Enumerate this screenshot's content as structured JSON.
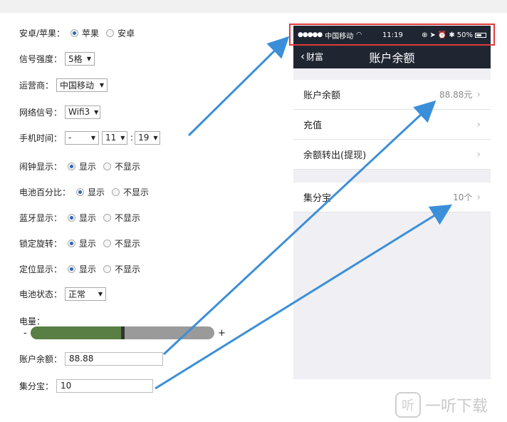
{
  "form": {
    "platform": {
      "label": "安卓/苹果：",
      "opt1": "苹果",
      "opt2": "安卓"
    },
    "signal": {
      "label": "信号强度：",
      "value": "5格"
    },
    "carrier": {
      "label": "运营商：",
      "value": "中国移动"
    },
    "network": {
      "label": "网络信号：",
      "value": "Wifi3"
    },
    "time": {
      "label": "手机时间：",
      "ampm": "-",
      "hour": "11",
      "colon": ":",
      "minute": "19"
    },
    "alarm": {
      "label": "闹钟显示：",
      "show": "显示",
      "hide": "不显示"
    },
    "battery_pct": {
      "label": "电池百分比：",
      "show": "显示",
      "hide": "不显示"
    },
    "bluetooth": {
      "label": "蓝牙显示：",
      "show": "显示",
      "hide": "不显示"
    },
    "rotation": {
      "label": "锁定旋转：",
      "show": "显示",
      "hide": "不显示"
    },
    "location": {
      "label": "定位显示：",
      "show": "显示",
      "hide": "不显示"
    },
    "battery_state": {
      "label": "电池状态：",
      "value": "正常"
    },
    "power": {
      "label": "电量：",
      "minus": "-",
      "plus": "+",
      "level": 0.5
    },
    "balance": {
      "label": "账户余额：",
      "value": "88.88"
    },
    "points": {
      "label": "集分宝：",
      "value": "10"
    }
  },
  "phone": {
    "status": {
      "dots": "●●●●●",
      "carrier": "中国移动",
      "time": "11:19",
      "pct": "50%"
    },
    "nav": {
      "back": "财富",
      "title": "账户余额"
    },
    "cells": [
      {
        "label": "账户余额",
        "value": "88.88元"
      },
      {
        "label": "充值"
      },
      {
        "label": "余额转出(提现)"
      },
      {
        "label": "集分宝",
        "value": "10个"
      }
    ]
  },
  "colors": {
    "arrow": "#3b8fd9",
    "highlight": "#e23a3a",
    "navbar": "#1f2631",
    "slider_fill": "#5a7f45"
  },
  "watermark": {
    "text": "一听下载"
  }
}
